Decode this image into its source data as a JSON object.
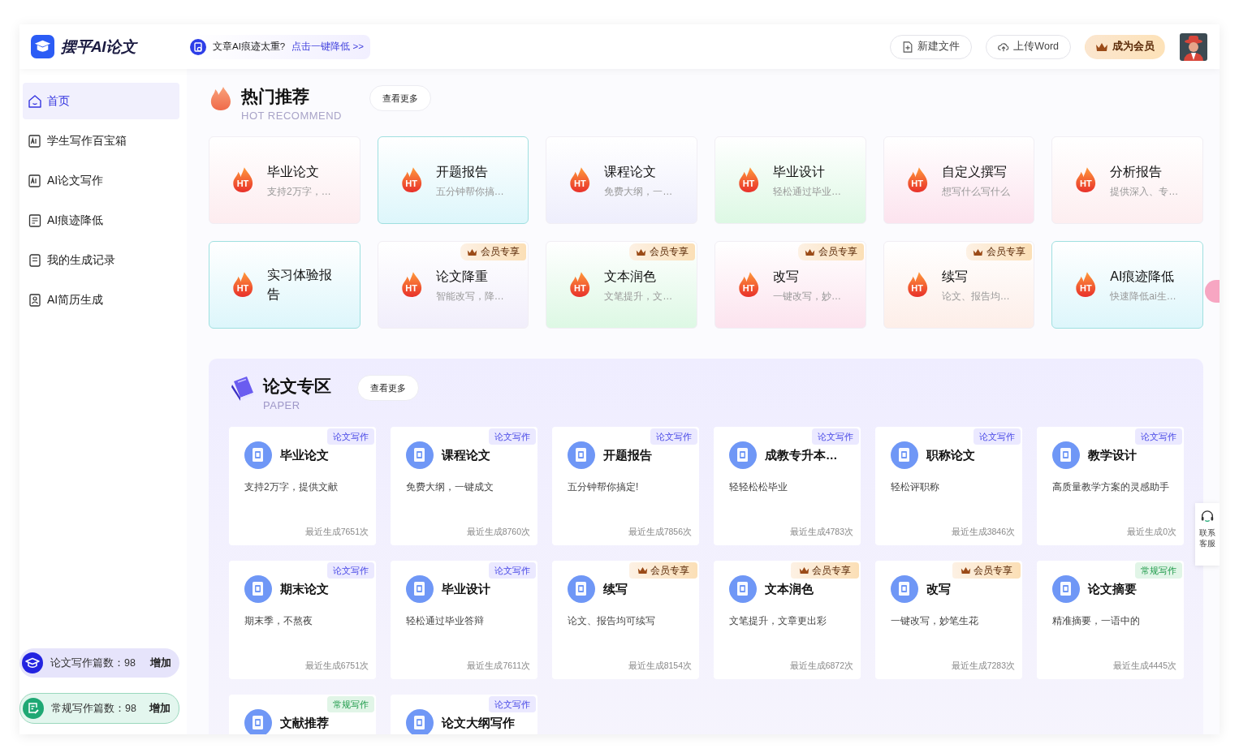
{
  "header": {
    "logo_text": "摆平AI论文",
    "notice": {
      "text": "文章AI痕迹太重?",
      "link": "点击一键降低 >>"
    },
    "buttons": [
      {
        "kind": "new-file",
        "label": "新建文件"
      },
      {
        "kind": "upload",
        "label": "上传Word"
      },
      {
        "kind": "member",
        "label": "成为会员"
      }
    ]
  },
  "sidebar": {
    "items": [
      {
        "label": "首页",
        "selected": true,
        "kind": "home"
      },
      {
        "label": "学生写作百宝箱",
        "selected": false,
        "kind": "ai"
      },
      {
        "label": "AI论文写作",
        "selected": false,
        "kind": "ai"
      },
      {
        "label": "AI痕迹降低",
        "selected": false,
        "kind": "doc"
      },
      {
        "label": "我的生成记录",
        "selected": false,
        "kind": "record"
      },
      {
        "label": "AI简历生成",
        "selected": false,
        "kind": "resume"
      }
    ],
    "quotas": [
      {
        "kind": "paper",
        "label": "论文写作篇数：98",
        "action": "增加"
      },
      {
        "kind": "regular",
        "label": "常规写作篇数：98",
        "action": "增加"
      }
    ]
  },
  "hot": {
    "title": "热门推荐",
    "subtitle": "HOT RECOMMEND",
    "more": "查看更多",
    "cards": [
      {
        "title": "毕业论文",
        "desc": "支持2万字，…",
        "icon_label": "HT",
        "member_only": false,
        "color": "#fdecef",
        "outlined": false
      },
      {
        "title": "开题报告",
        "desc": "五分钟帮你搞…",
        "icon_label": "HT",
        "member_only": false,
        "color": "#ddf6fb",
        "outlined": true
      },
      {
        "title": "课程论文",
        "desc": "免费大纲，一…",
        "icon_label": "HT",
        "member_only": false,
        "color": "#eeeefc",
        "outlined": false
      },
      {
        "title": "毕业设计",
        "desc": "轻松通过毕业…",
        "icon_label": "HT",
        "member_only": false,
        "color": "#ddf8e4",
        "outlined": false
      },
      {
        "title": "自定义撰写",
        "desc": "想写什么写什么",
        "icon_label": "HT",
        "member_only": false,
        "color": "#fce3ee",
        "outlined": false
      },
      {
        "title": "分析报告",
        "desc": "提供深入、专…",
        "icon_label": "HT",
        "member_only": false,
        "color": "#fdeef0",
        "outlined": false
      },
      {
        "title": "实习体验报告",
        "icon_label": "HT",
        "member_only": false,
        "color": "#ddf6fb",
        "outlined": true
      },
      {
        "title": "论文降重",
        "desc": "智能改写，降…",
        "icon_label": "HT",
        "member_only": true,
        "badge": "会员专享",
        "color": "#f1eefb",
        "outlined": false
      },
      {
        "title": "文本润色",
        "desc": "文笔提升，文…",
        "icon_label": "HT",
        "member_only": true,
        "badge": "会员专享",
        "color": "#ddf8e4",
        "outlined": false
      },
      {
        "title": "改写",
        "desc": "一键改写，妙…",
        "icon_label": "HT",
        "member_only": true,
        "badge": "会员专享",
        "color": "#fce3ee",
        "outlined": false
      },
      {
        "title": "续写",
        "desc": "论文、报告均…",
        "icon_label": "HT",
        "member_only": true,
        "badge": "会员专享",
        "color": "#fdeee8",
        "outlined": false
      },
      {
        "title": "AI痕迹降低",
        "desc": "快速降低ai生…",
        "icon_label": "HT",
        "member_only": false,
        "color": "#ddf6fb",
        "outlined": true
      }
    ]
  },
  "paper": {
    "title": "论文专区",
    "subtitle": "PAPER",
    "more": "查看更多",
    "cards": [
      {
        "tag": {
          "kind": "paper",
          "text": "论文写作"
        },
        "title": "毕业论文",
        "desc": "支持2万字，提供文献",
        "count": "最近生成7651次"
      },
      {
        "tag": {
          "kind": "paper",
          "text": "论文写作"
        },
        "title": "课程论文",
        "desc": "免费大纲，一键成文",
        "count": "最近生成8760次"
      },
      {
        "tag": {
          "kind": "paper",
          "text": "论文写作"
        },
        "title": "开题报告",
        "desc": "五分钟帮你搞定!",
        "count": "最近生成7856次"
      },
      {
        "tag": {
          "kind": "paper",
          "text": "论文写作"
        },
        "title": "成教专升本…",
        "desc": "轻轻松松毕业",
        "count": "最近生成4783次"
      },
      {
        "tag": {
          "kind": "paper",
          "text": "论文写作"
        },
        "title": "职称论文",
        "desc": "轻松评职称",
        "count": "最近生成3846次"
      },
      {
        "tag": {
          "kind": "paper",
          "text": "论文写作"
        },
        "title": "教学设计",
        "desc": "高质量教学方案的灵感助手",
        "count": "最近生成0次"
      },
      {
        "tag": {
          "kind": "paper",
          "text": "论文写作"
        },
        "title": "期末论文",
        "desc": "期末季，不熬夜",
        "count": "最近生成6751次"
      },
      {
        "tag": {
          "kind": "paper",
          "text": "论文写作"
        },
        "title": "毕业设计",
        "desc": "轻松通过毕业答辩",
        "count": "最近生成7611次"
      },
      {
        "tag": {
          "kind": "member",
          "text": "会员专享"
        },
        "title": "续写",
        "desc": "论文、报告均可续写",
        "count": "最近生成8154次"
      },
      {
        "tag": {
          "kind": "member",
          "text": "会员专享"
        },
        "title": "文本润色",
        "desc": "文笔提升，文章更出彩",
        "count": "最近生成6872次"
      },
      {
        "tag": {
          "kind": "member",
          "text": "会员专享"
        },
        "title": "改写",
        "desc": "一键改写，妙笔生花",
        "count": "最近生成7283次"
      },
      {
        "tag": {
          "kind": "regular",
          "text": "常规写作"
        },
        "title": "论文摘要",
        "desc": "精准摘要，一语中的",
        "count": "最近生成4445次"
      },
      {
        "tag": {
          "kind": "regular",
          "text": "常规写作"
        },
        "title": "文献推荐"
      },
      {
        "tag": {
          "kind": "paper",
          "text": "论文写作"
        },
        "title": "论文大纲写作"
      }
    ]
  },
  "service": {
    "label": "联系客服"
  }
}
